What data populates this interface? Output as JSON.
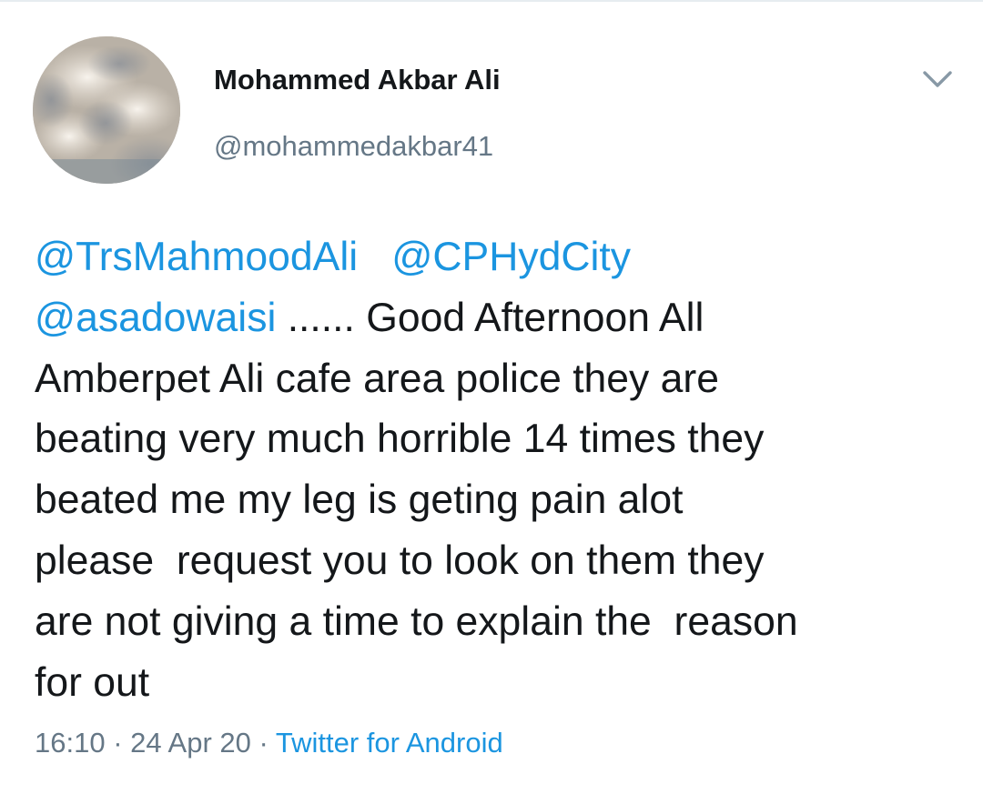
{
  "author": {
    "display_name": "Mohammed Akbar Ali",
    "handle": "@mohammedakbar41"
  },
  "tweet": {
    "mentions": [
      "@TrsMahmoodAli",
      "@CPHydCity",
      "@asadowaisi"
    ],
    "separator_1": "   ",
    "line2_text": " ...... Good Afternoon All",
    "lines": [
      "Amberpet Ali cafe area police they are",
      "beating very much horrible 14 times they",
      "beated me my leg is geting pain alot",
      "please  request you to look on them they",
      "are not giving a time to explain the  reason",
      "for out"
    ]
  },
  "meta": {
    "time": "16:10",
    "dot": " · ",
    "date": "24 Apr 20",
    "source": "Twitter for Android"
  },
  "colors": {
    "mention": "#1b95e0",
    "text": "#14171a",
    "secondary": "#657786"
  },
  "icons": {
    "menu": "chevron-down-icon"
  }
}
